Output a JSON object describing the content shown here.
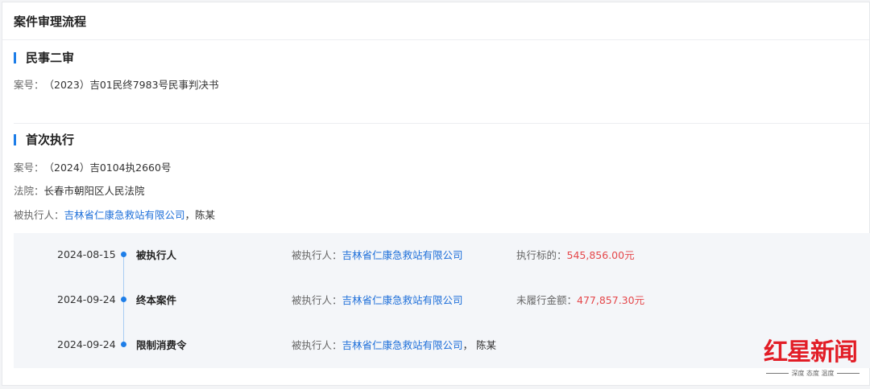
{
  "panel": {
    "title": "案件审理流程"
  },
  "civil_second": {
    "title": "民事二审",
    "case_no_label": "案号：",
    "case_no": "（2023）吉01民终7983号民事判决书"
  },
  "first_exec": {
    "title": "首次执行",
    "case_no_label": "案号：",
    "case_no": "（2024）吉0104执2660号",
    "court_label": "法院：",
    "court": "长春市朝阳区人民法院",
    "party_label": "被执行人：",
    "party_company": "吉林省仁康急救站有限公司",
    "party_sep": "，",
    "party_person": "陈某"
  },
  "timeline": [
    {
      "date": "2024-08-15",
      "type": "被执行人",
      "party_label": "被执行人：",
      "party_company": "吉林省仁康急救站有限公司",
      "party_extra": "",
      "amount_label": "执行标的：",
      "amount": "545,856.00元"
    },
    {
      "date": "2024-09-24",
      "type": "终本案件",
      "party_label": "被执行人：",
      "party_company": "吉林省仁康急救站有限公司",
      "party_extra": "",
      "amount_label": "未履行金额：",
      "amount": "477,857.30元"
    },
    {
      "date": "2024-09-24",
      "type": "限制消费令",
      "party_label": "被执行人：",
      "party_company": "吉林省仁康急救站有限公司",
      "party_extra": "， 陈某",
      "amount_label": "",
      "amount": ""
    }
  ],
  "watermark": {
    "name": "红星新闻",
    "slogan": "深度 态度 温度"
  },
  "colors": {
    "accent": "#1e7ee8",
    "link": "#1e6fd9",
    "amount": "#e5474a",
    "logo": "#e21d26"
  }
}
